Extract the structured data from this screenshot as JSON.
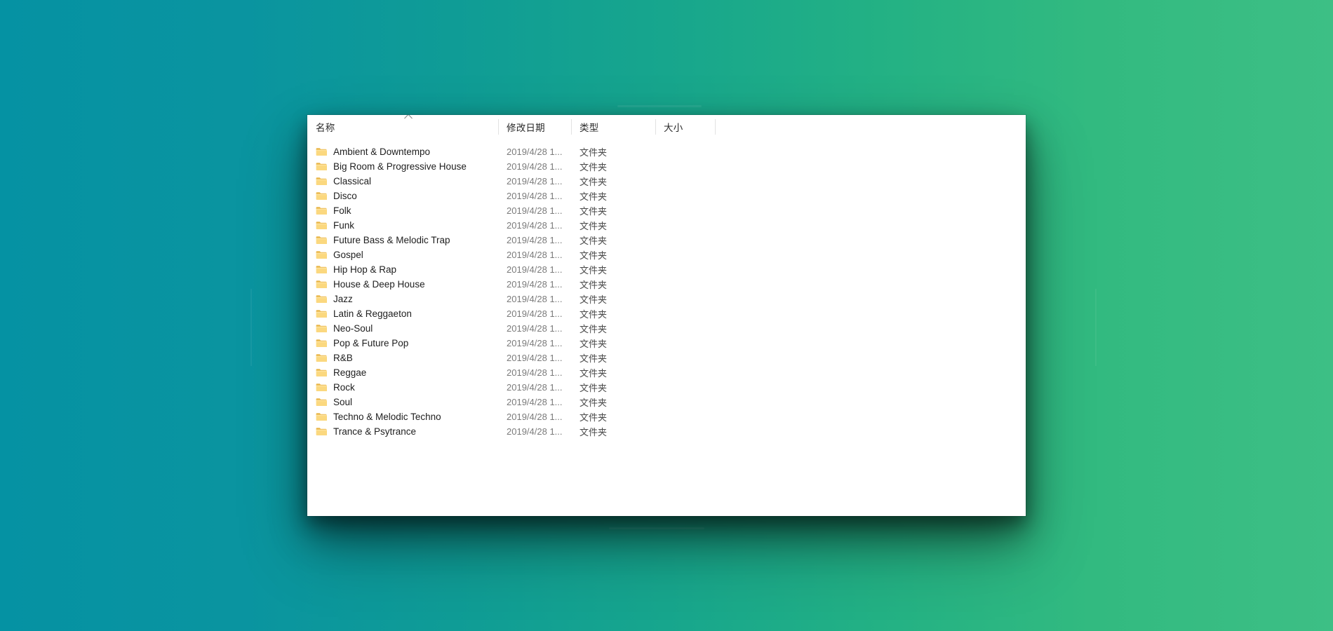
{
  "desktop": {
    "background_from": "#0592a3",
    "background_to": "#3dbf85"
  },
  "window": {
    "name": "file-explorer-window",
    "corner_mark": "⌐"
  },
  "columns": [
    {
      "key": "name",
      "label": "名称",
      "sorted": true,
      "sort_direction": "ascending"
    },
    {
      "key": "date",
      "label": "修改日期",
      "sorted": false,
      "sort_direction": ""
    },
    {
      "key": "type",
      "label": "类型",
      "sorted": false,
      "sort_direction": ""
    },
    {
      "key": "size",
      "label": "大小",
      "sorted": false,
      "sort_direction": ""
    }
  ],
  "files": [
    {
      "name": "Ambient & Downtempo",
      "date": "2019/4/28 1...",
      "type": "文件夹",
      "size": "",
      "icon": "folder-icon"
    },
    {
      "name": "Big Room & Progressive House",
      "date": "2019/4/28 1...",
      "type": "文件夹",
      "size": "",
      "icon": "folder-icon"
    },
    {
      "name": "Classical",
      "date": "2019/4/28 1...",
      "type": "文件夹",
      "size": "",
      "icon": "folder-icon"
    },
    {
      "name": "Disco",
      "date": "2019/4/28 1...",
      "type": "文件夹",
      "size": "",
      "icon": "folder-icon"
    },
    {
      "name": "Folk",
      "date": "2019/4/28 1...",
      "type": "文件夹",
      "size": "",
      "icon": "folder-icon"
    },
    {
      "name": "Funk",
      "date": "2019/4/28 1...",
      "type": "文件夹",
      "size": "",
      "icon": "folder-icon"
    },
    {
      "name": "Future Bass & Melodic Trap",
      "date": "2019/4/28 1...",
      "type": "文件夹",
      "size": "",
      "icon": "folder-icon"
    },
    {
      "name": "Gospel",
      "date": "2019/4/28 1...",
      "type": "文件夹",
      "size": "",
      "icon": "folder-icon"
    },
    {
      "name": "Hip Hop & Rap",
      "date": "2019/4/28 1...",
      "type": "文件夹",
      "size": "",
      "icon": "folder-icon"
    },
    {
      "name": "House & Deep House",
      "date": "2019/4/28 1...",
      "type": "文件夹",
      "size": "",
      "icon": "folder-icon"
    },
    {
      "name": "Jazz",
      "date": "2019/4/28 1...",
      "type": "文件夹",
      "size": "",
      "icon": "folder-icon"
    },
    {
      "name": "Latin & Reggaeton",
      "date": "2019/4/28 1...",
      "type": "文件夹",
      "size": "",
      "icon": "folder-icon"
    },
    {
      "name": "Neo-Soul",
      "date": "2019/4/28 1...",
      "type": "文件夹",
      "size": "",
      "icon": "folder-icon"
    },
    {
      "name": "Pop & Future Pop",
      "date": "2019/4/28 1...",
      "type": "文件夹",
      "size": "",
      "icon": "folder-icon"
    },
    {
      "name": "R&B",
      "date": "2019/4/28 1...",
      "type": "文件夹",
      "size": "",
      "icon": "folder-icon"
    },
    {
      "name": "Reggae",
      "date": "2019/4/28 1...",
      "type": "文件夹",
      "size": "",
      "icon": "folder-icon"
    },
    {
      "name": "Rock",
      "date": "2019/4/28 1...",
      "type": "文件夹",
      "size": "",
      "icon": "folder-icon"
    },
    {
      "name": "Soul",
      "date": "2019/4/28 1...",
      "type": "文件夹",
      "size": "",
      "icon": "folder-icon"
    },
    {
      "name": "Techno & Melodic Techno",
      "date": "2019/4/28 1...",
      "type": "文件夹",
      "size": "",
      "icon": "folder-icon"
    },
    {
      "name": "Trance & Psytrance",
      "date": "2019/4/28 1...",
      "type": "文件夹",
      "size": "",
      "icon": "folder-icon"
    }
  ]
}
